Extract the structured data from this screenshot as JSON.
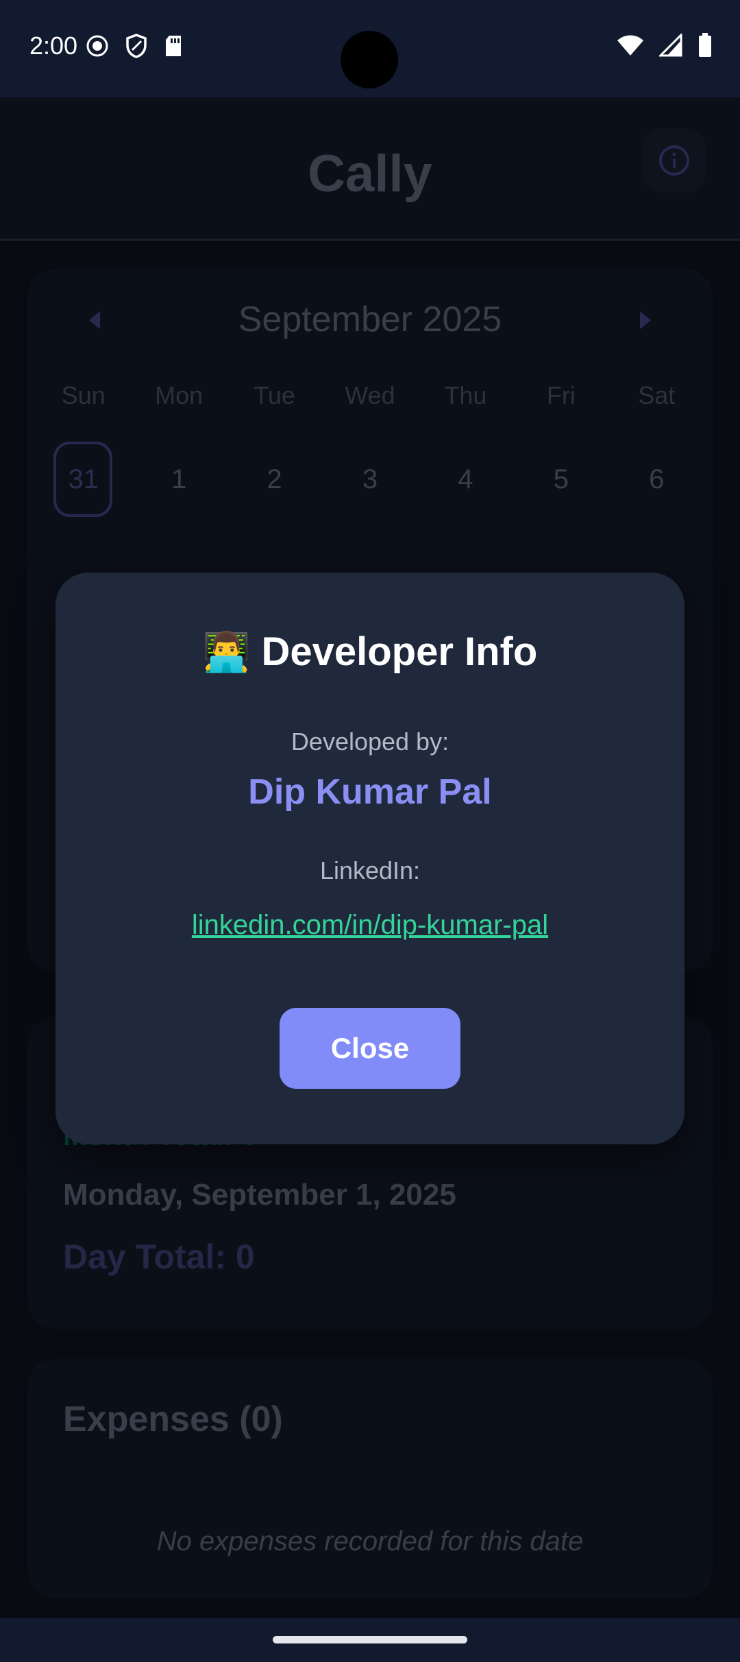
{
  "status_bar": {
    "time": "2:00",
    "left_icons": [
      "record-icon",
      "shield-icon",
      "sd-card-icon"
    ],
    "right_icons": [
      "wifi-icon",
      "signal-icon",
      "battery-icon"
    ]
  },
  "app_bar": {
    "title": "Cally",
    "info_icon": "info-icon"
  },
  "calendar": {
    "month_label": "September 2025",
    "weekdays": [
      "Sun",
      "Mon",
      "Tue",
      "Wed",
      "Thu",
      "Fri",
      "Sat"
    ],
    "days": [
      "31",
      "1",
      "2",
      "3",
      "4",
      "5",
      "6"
    ],
    "selected_day": "31"
  },
  "summary": {
    "month_total": "Month Total: 0",
    "date": "Monday, September 1, 2025",
    "day_total": "Day Total: 0"
  },
  "expenses": {
    "title": "Expenses (0)",
    "empty_message": "No expenses recorded for this date"
  },
  "dialog": {
    "emoji": "👨‍💻",
    "title": "Developer Info",
    "developed_by_label": "Developed by:",
    "developer_name": "Dip Kumar Pal",
    "linkedin_label": "LinkedIn:",
    "linkedin_url": "linkedin.com/in/dip-kumar-pal",
    "close_label": "Close"
  },
  "colors": {
    "dialog_bg": "#1f293b",
    "accent": "#818cf8",
    "link": "#34d399"
  }
}
